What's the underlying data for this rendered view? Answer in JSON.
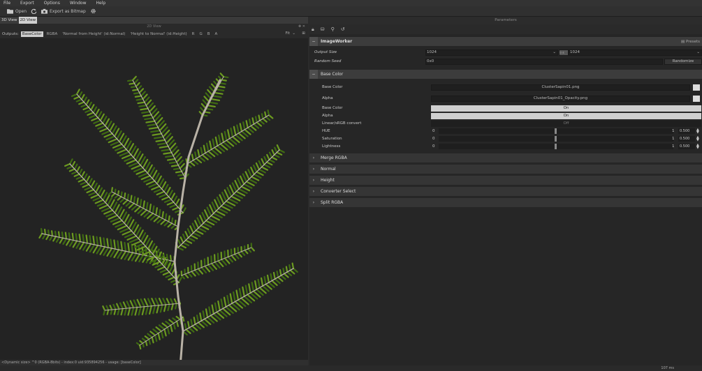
{
  "menu": [
    "File",
    "Export",
    "Options",
    "Window",
    "Help"
  ],
  "toolbar": {
    "open_label": "Open",
    "export_label": "Export as Bitmap"
  },
  "left": {
    "tabs": [
      "3D View",
      "2D View"
    ],
    "subheader": "2D View",
    "outputs_label": "Outputs:",
    "outputs": [
      "BaseColor",
      "RGBA",
      "'Normal from Height' (id:Normal)",
      "'Height to Normal' (id:Height)",
      "R",
      "G",
      "B",
      "A"
    ],
    "fit_label": "Fit",
    "status": "<Dynamic size> ^0 (RGBA-8bits) - index:0 uid:935894256 - usage: [baseColor]"
  },
  "right": {
    "title": "Parameters",
    "worker": {
      "label": "ImageWorker",
      "presets_label": "Presets",
      "output_size_label": "Output Size",
      "output_size_w": "1024",
      "output_size_h": "1024",
      "link_label": "link",
      "random_seed_label": "Random Seed",
      "random_seed_value": "0x0",
      "randomize_label": "Randomize"
    },
    "basecolor": {
      "label": "Base Color",
      "rows": {
        "base_color_label": "Base Color",
        "base_color_file": "ClusterSapin01.png",
        "alpha_label": "Alpha",
        "alpha_file": "ClusterSapin01_Opacity.png",
        "base_color2_label": "Base Color",
        "base_color2_value": "On",
        "alpha2_label": "Alpha",
        "alpha2_value": "On",
        "linear_label": "Linear/sRGB convert",
        "linear_value": "Off",
        "hue_label": "HUE",
        "hue_min": "0",
        "hue_max": "1",
        "hue_value": "0.500",
        "sat_label": "Saturation",
        "sat_min": "0",
        "sat_max": "1",
        "sat_value": "0.500",
        "light_label": "Lightness",
        "light_min": "0",
        "light_max": "1",
        "light_value": "0.500"
      }
    },
    "sections": [
      "Merge RGBA",
      "Normal",
      "Height",
      "Converter Select",
      "Split RGBA"
    ]
  },
  "bottom": {
    "time": "107 ms"
  },
  "colors": {
    "leaf": "#6b9a1f",
    "leaf_dark": "#3f6b12",
    "stem": "#b9b2a6",
    "bg": "#232323"
  }
}
